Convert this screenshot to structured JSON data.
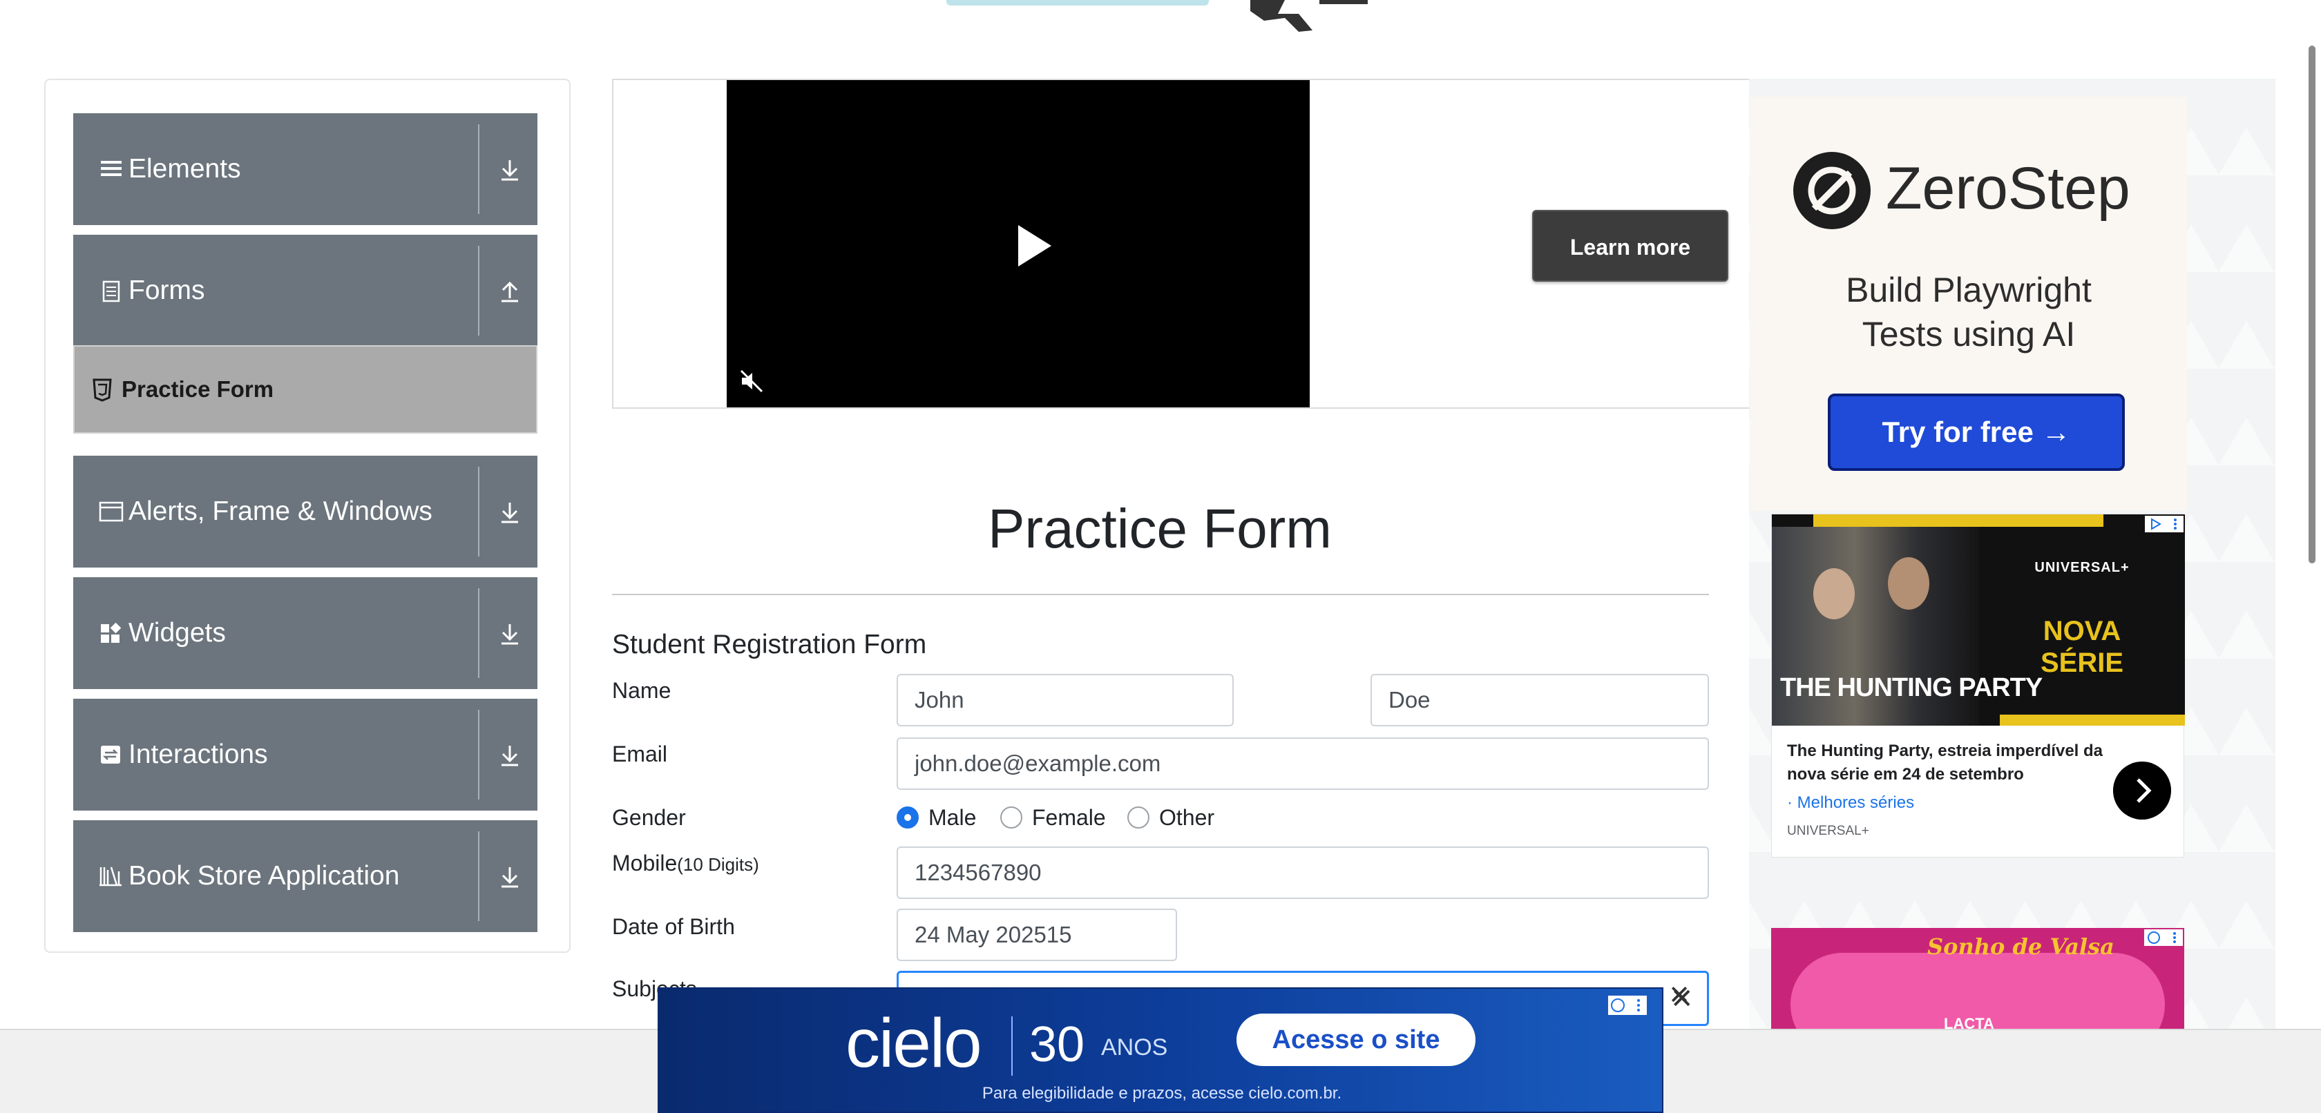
{
  "sidebar": {
    "groups": [
      {
        "label": "Elements",
        "icon": "hamburger-icon",
        "arrow": "download-arrow-icon"
      },
      {
        "label": "Forms",
        "icon": "document-icon",
        "arrow": "upload-arrow-icon"
      },
      {
        "label": "Alerts, Frame & Windows",
        "icon": "window-icon",
        "arrow": "download-arrow-icon"
      },
      {
        "label": "Widgets",
        "icon": "widgets-icon",
        "arrow": "download-arrow-icon"
      },
      {
        "label": "Interactions",
        "icon": "interactions-icon",
        "arrow": "download-arrow-icon"
      },
      {
        "label": "Book Store Application",
        "icon": "books-icon",
        "arrow": "download-arrow-icon"
      }
    ],
    "active_item": {
      "label": "Practice Form",
      "icon": "html5-icon"
    }
  },
  "video_ad": {
    "learn_more": "Learn more"
  },
  "zerostep_ad": {
    "brand": "ZeroStep",
    "tagline_1": "Build Playwright",
    "tagline_2": "Tests using AI",
    "cta": "Try for free →"
  },
  "hunting_party_ad": {
    "title": "THE HUNTING PARTY",
    "brand": "UNIVERSAL+",
    "nova": "NOVA",
    "serie": "SÉRIE",
    "description": "The Hunting Party, estreia imperdível da nova série em 24 de setembro",
    "link": "Melhores séries",
    "source": "UNIVERSAL+"
  },
  "sonho_ad": {
    "logo": "Sonho de Valsa",
    "brand": "LACTA"
  },
  "form": {
    "title": "Practice Form",
    "subtitle": "Student Registration Form",
    "name_label": "Name",
    "first_name": "John",
    "last_name": "Doe",
    "email_label": "Email",
    "email": "john.doe@example.com",
    "gender_label": "Gender",
    "gender_options": [
      "Male",
      "Female",
      "Other"
    ],
    "gender_selected": "Male",
    "mobile_label": "Mobile",
    "mobile_hint": "(10 Digits)",
    "mobile": "1234567890",
    "dob_label": "Date of Birth",
    "dob": "24 May 202515",
    "subjects_label": "Subjects"
  },
  "cielo_ad": {
    "logo": "cielo",
    "thirty": "30",
    "anos": "ANOS",
    "cta": "Acesse o site",
    "note": "Para elegibilidade e prazos, acesse cielo.com.br.",
    "close": "✕"
  },
  "colors": {
    "sidebar_bg": "#6c757d",
    "active_item_bg": "#aaaaaa",
    "radio_selected": "#1a73e8",
    "zerostep_button": "#1f4bd8",
    "focus_border": "#2684ff"
  }
}
